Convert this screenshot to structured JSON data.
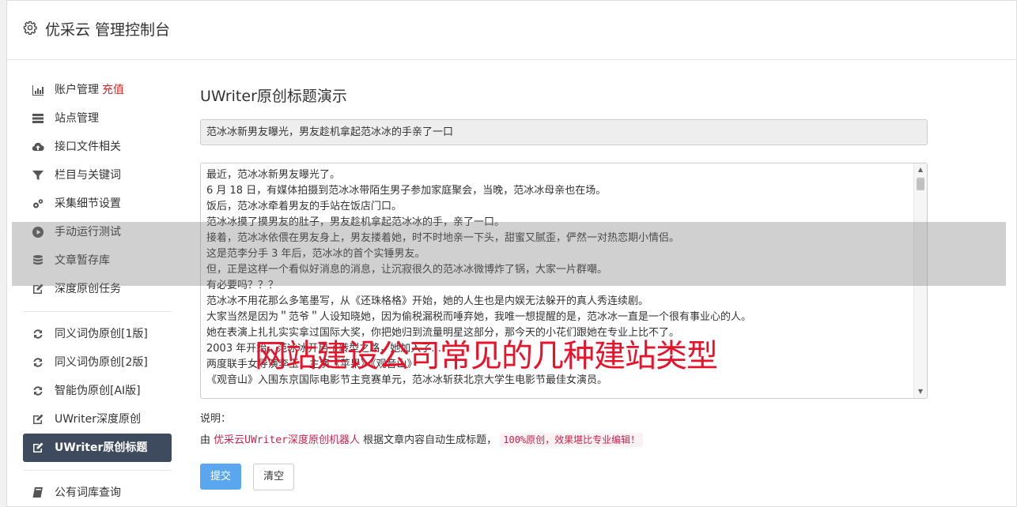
{
  "header": {
    "title": "优采云 管理控制台",
    "icon": "gear-icon"
  },
  "sidebar": {
    "items": [
      {
        "label": "账户管理",
        "badge": "充值",
        "icon": "bar-chart-icon"
      },
      {
        "label": "站点管理",
        "icon": "server-icon"
      },
      {
        "label": "接口文件相关",
        "icon": "cloud-upload-icon"
      },
      {
        "label": "栏目与关键词",
        "icon": "filter-icon"
      },
      {
        "label": "采集细节设置",
        "icon": "gears-icon"
      },
      {
        "label": "手动运行测试",
        "icon": "play-icon"
      },
      {
        "label": "文章暂存库",
        "icon": "database-icon"
      },
      {
        "label": "深度原创任务",
        "icon": "edit-icon"
      },
      {
        "label": "同义词伪原创[1版]",
        "icon": "refresh-icon"
      },
      {
        "label": "同义词伪原创[2版]",
        "icon": "refresh-icon"
      },
      {
        "label": "智能伪原创[AI版]",
        "icon": "refresh-icon"
      },
      {
        "label": "UWriter深度原创",
        "icon": "edit-icon"
      },
      {
        "label": "UWriter原创标题",
        "icon": "edit-icon",
        "active": true
      },
      {
        "label": "公有词库查询",
        "icon": "book-icon"
      }
    ]
  },
  "main": {
    "title": "UWriter原创标题演示",
    "title_field": "范冰冰新男友曝光，男友趁机拿起范冰冰的手亲了一口",
    "body_lines": [
      "最近，范冰冰新男友曝光了。",
      "6 月 18 日，有媒体拍摄到范冰冰带陌生男子参加家庭聚会，当晚，范冰冰母亲也在场。",
      "饭后，范冰冰牵着男友的手站在饭店门口。",
      "范冰冰摸了摸男友的肚子，男友趁机拿起范冰冰的手，亲了一口。",
      "接着，范冰冰依偎在男友身上，男友搂着她，时不时地亲一下头，甜蜜又腻歪，俨然一对热恋期小情侣。",
      "这是范李分手 3 年后，范冰冰的首个实锤男友。",
      "但，正是这样一个看似好消息的消息，让沉寂很久的范冰冰微博炸了锅，大家一片群嘲。",
      "有必要吗？？？",
      "范冰冰不用花那么多笔墨写，从《还珠格格》开始，她的人生也是内娱无法躲开的真人秀连续剧。",
      "大家当然是因为＂范爷＂人设知晓她，因为偷税漏税而唾弃她，我唯一想提醒的是，范冰冰一直是一个很有事业心的人。",
      "她在表演上扎扎实实拿过国际大奖，你把她归到流量明星这部分，那今天的小花们跟她在专业上比不了。",
      "2003 年开始，范冰冰开启了转型之路，她加入了…",
      "两度联手女导演李玉，主演《苹果》《观音山》",
      "《观音山》入围东京国际电影节主竞赛单元，范冰冰斩获北京大学生电影节最佳女演员。"
    ],
    "note_label": "说明：",
    "note_prefix": "由",
    "note_highlight": "优采云UWriter深度原创机器人",
    "note_middle": "根据文章内容自动生成标题，",
    "note_code": "100%原创，效果堪比专业编辑！",
    "submit_label": "提交",
    "clear_label": "清空"
  },
  "watermark": "网站建设公司常见的几种建站类型"
}
